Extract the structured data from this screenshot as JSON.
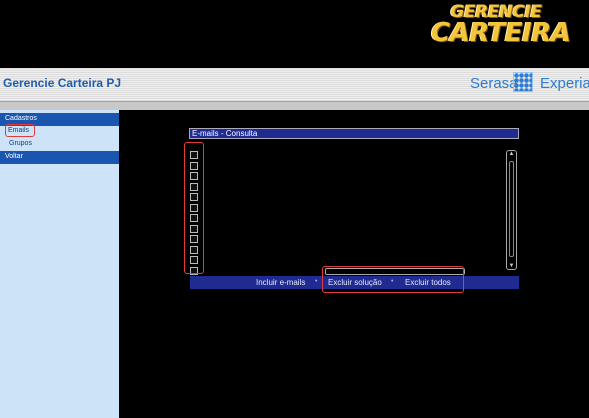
{
  "logo": {
    "line1": "GERENCIE",
    "line2": "CARTEIRA"
  },
  "header": {
    "app_title": "Gerencie Carteira PJ",
    "brand_left": "Serasa",
    "brand_right": "Experian"
  },
  "subbar": {
    "breadcrumb": ""
  },
  "sidebar": {
    "section": "Cadastros",
    "items": [
      {
        "label": "Emails"
      },
      {
        "label": "Grupos"
      }
    ],
    "back": "Voltar"
  },
  "dialog": {
    "title": "E-mails - Consulta",
    "rows": [
      {
        "text": ""
      },
      {
        "text": ""
      },
      {
        "text": ""
      },
      {
        "text": ""
      },
      {
        "text": ""
      },
      {
        "text": ""
      },
      {
        "text": ""
      },
      {
        "text": ""
      },
      {
        "text": ""
      },
      {
        "text": ""
      },
      {
        "text": ""
      },
      {
        "text": ""
      }
    ],
    "actions": {
      "include": "Incluir e-mails",
      "delete_selection": "Excluir solução",
      "delete_all": "Excluir todos"
    },
    "separator": "•"
  },
  "colors": {
    "accent": "#1a55b0",
    "highlight": "#e03c3c",
    "logo": "#f3c53a"
  }
}
